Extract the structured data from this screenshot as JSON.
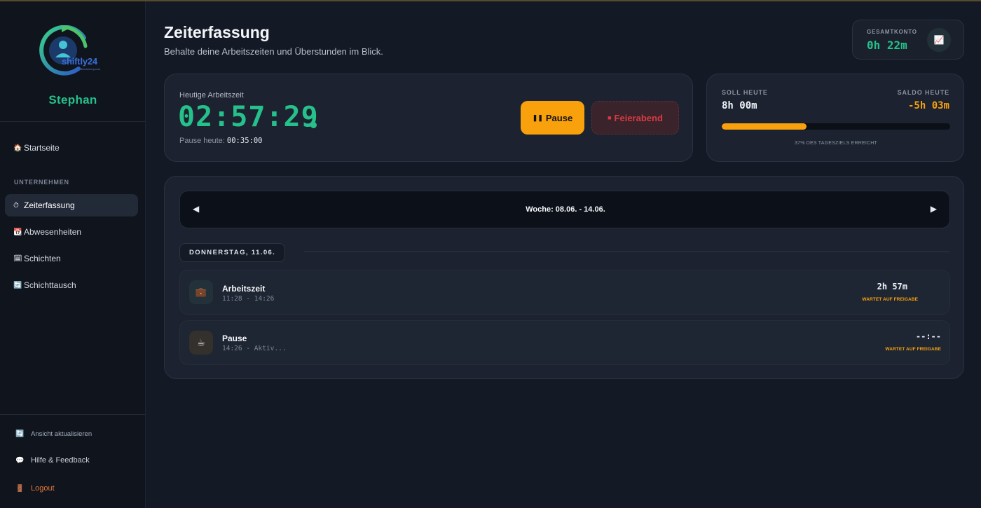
{
  "brand": {
    "logo_text": "shiftly24",
    "logo_tagline": "Mitarbeiterportal"
  },
  "user": {
    "name": "Stephan"
  },
  "sidebar": {
    "home": {
      "icon": "house-icon",
      "label": "Startseite"
    },
    "section_label": "UNTERNEHMEN",
    "items": [
      {
        "icon": "stopwatch-icon",
        "label": "Zeiterfassung",
        "active": true
      },
      {
        "icon": "calendar-icon",
        "label": "Abwesenheiten",
        "active": false
      },
      {
        "icon": "schedule-icon",
        "label": "Schichten",
        "active": false
      },
      {
        "icon": "swap-icon",
        "label": "Schichttausch",
        "active": false
      }
    ],
    "footer": {
      "refresh": {
        "icon": "refresh-icon",
        "label": "Ansicht aktualisieren"
      },
      "help": {
        "icon": "speech-bubble-icon",
        "label": "Hilfe & Feedback"
      },
      "logout": {
        "icon": "door-icon",
        "label": "Logout"
      }
    }
  },
  "header": {
    "title": "Zeiterfassung",
    "subtitle": "Behalte deine Arbeitszeiten und Überstunden im Blick."
  },
  "gesamtkonto": {
    "label": "GESAMTKONTO",
    "value": "0h 22m",
    "icon": "chart-icon"
  },
  "today": {
    "label": "Heutige Arbeitszeit",
    "timer": "02:57:29",
    "pause_label": "Pause heute:",
    "pause_value": "00:35:00",
    "pause_button": "Pause",
    "end_button": "Feierabend"
  },
  "soll": {
    "soll_label": "SOLL HEUTE",
    "soll_value": "8h 00m",
    "saldo_label": "SALDO HEUTE",
    "saldo_value": "-5h 03m",
    "progress_fraction": 0.37,
    "progress_text": "37% DES TAGESZIELS ERREICHT"
  },
  "week": {
    "label": "Woche: 08.06. - 14.06.",
    "prev_icon": "triangle-left-icon",
    "next_icon": "triangle-right-icon",
    "day_label": "DONNERSTAG, 11.06.",
    "entries": [
      {
        "icon": "briefcase-icon",
        "title": "Arbeitszeit",
        "time": "11:28 - 14:26",
        "duration": "2h 57m",
        "status": "WARTET AUF FREIGABE"
      },
      {
        "icon": "coffee-icon",
        "title": "Pause",
        "time": "14:26 - Aktiv...",
        "duration": "--:--",
        "status": "WARTET AUF FREIGABE"
      }
    ]
  },
  "colors": {
    "accent_green": "#26c08a",
    "accent_orange": "#f8a10d",
    "danger_red": "#d93a44",
    "background": "#131a26"
  }
}
